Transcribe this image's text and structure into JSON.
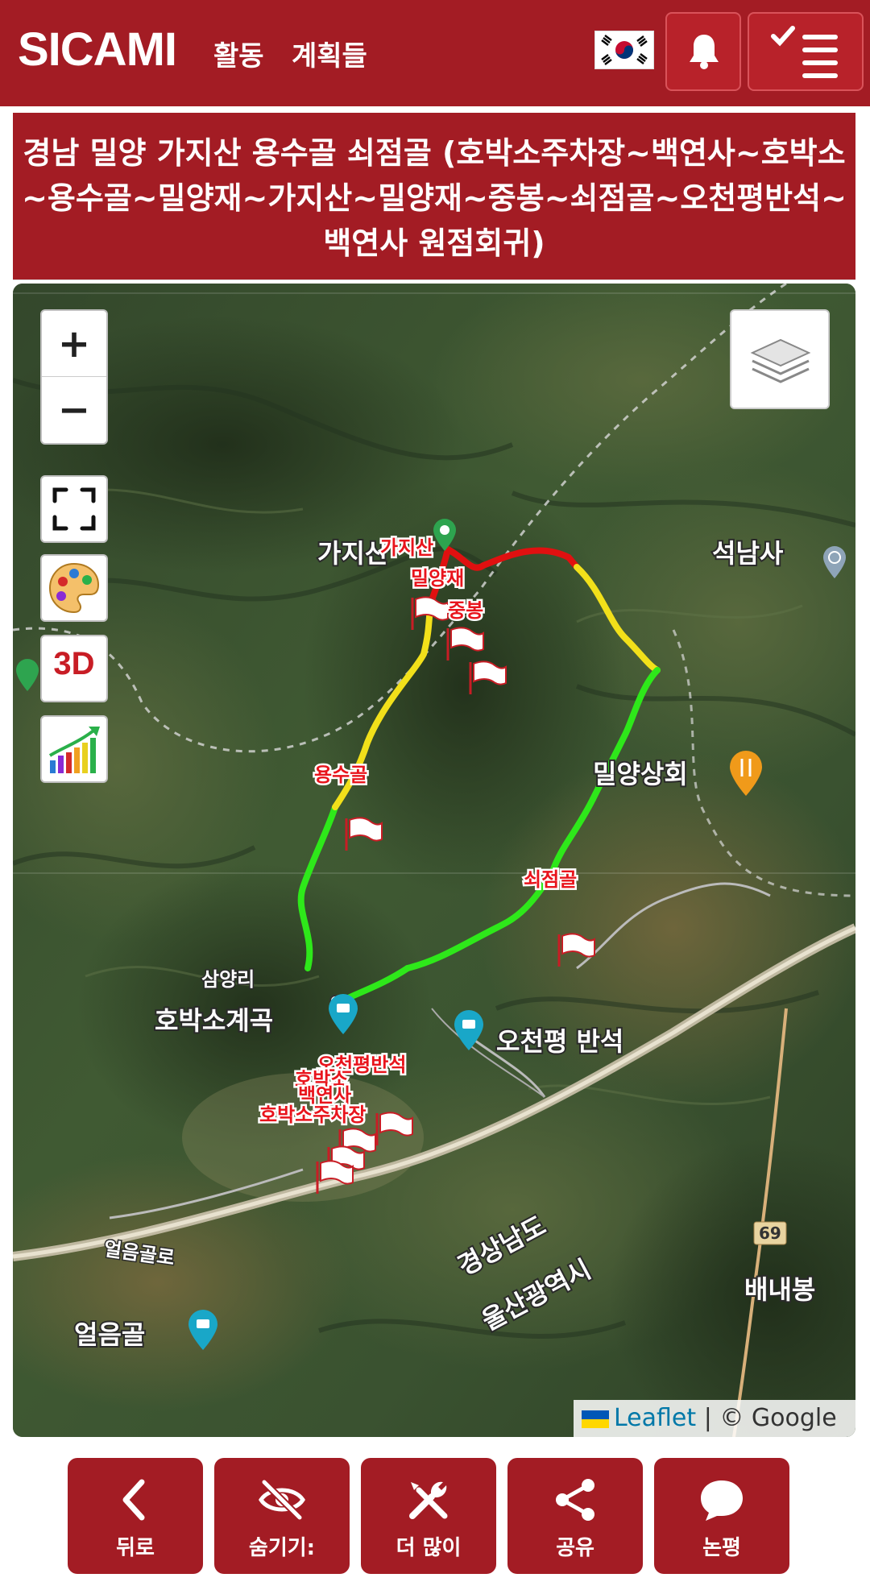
{
  "header": {
    "logo": "SICAMI",
    "nav": [
      "활동",
      "계획들"
    ],
    "flag": "south-korea-flag",
    "notification_icon": "bell-icon",
    "menu_icon": "check-menu-icon"
  },
  "page_title": "경남 밀양 가지산 용수골 쇠점골 (호박소주차장~백연사~호박소~용수골~밀양재~가지산~밀양재~중봉~쇠점골~오천평반석~백연사 원점회귀)",
  "map": {
    "zoom_in": "+",
    "zoom_out": "−",
    "btn_3d": "3D",
    "attribution": {
      "leaflet": "Leaflet",
      "separator": "|",
      "google": "© Google"
    },
    "route_colors": {
      "red": "#e01010",
      "yellow": "#f2e01a",
      "green": "#2ee81a"
    },
    "place_labels": {
      "gajisan": "가지산",
      "seoknamsa": "석남사",
      "miryang_sanghoe": "밀양상회",
      "samyangri": "삼양리",
      "hobakso_gyegok": "호박소계곡",
      "ocheonpyeong_banseok": "오천평 반석",
      "eolleumgolro": "얼음골로",
      "eolleumgol": "얼음골",
      "gyeongsangnamdo": "경상남도",
      "ulsan": "울산광역시",
      "baenaebong": "배내봉",
      "road_69": "69"
    },
    "waypoints": {
      "gajisan": "가지산",
      "miryangjae": "밀양재",
      "jungbong": "중봉",
      "yongsugol": "용수골",
      "soejeomgol": "쇠점골",
      "ocheonpyeong": "오천평반석",
      "hobakso": "호박소",
      "baegyeonsa": "백연사",
      "parking": "호박소주차장"
    }
  },
  "toolbar": {
    "back": "뒤로",
    "hide": "숨기기:",
    "more": "더 많이",
    "share": "공유",
    "comment": "논평"
  }
}
